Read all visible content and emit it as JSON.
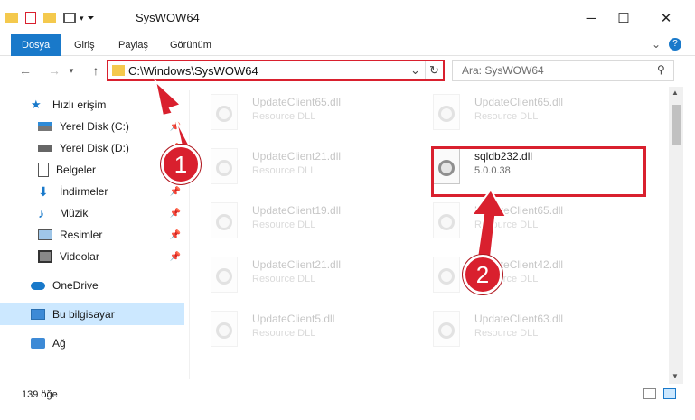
{
  "window": {
    "title": "SysWOW64",
    "minimize_icon": "minimize-icon",
    "maximize_icon": "maximize-icon",
    "close_icon": "close-icon"
  },
  "ribbon": {
    "tabs": [
      {
        "label": "Dosya",
        "active": true
      },
      {
        "label": "Giriş",
        "active": false
      },
      {
        "label": "Paylaş",
        "active": false
      },
      {
        "label": "Görünüm",
        "active": false
      }
    ]
  },
  "address": {
    "path": "C:\\Windows\\SysWOW64"
  },
  "search": {
    "placeholder": "Ara: SysWOW64"
  },
  "sidebar": {
    "items": [
      {
        "label": "Hızlı erişim"
      },
      {
        "label": "Yerel Disk (C:)"
      },
      {
        "label": "Yerel Disk (D:)"
      },
      {
        "label": "Belgeler"
      },
      {
        "label": "İndirmeler"
      },
      {
        "label": "Müzik"
      },
      {
        "label": "Resimler"
      },
      {
        "label": "Videolar"
      },
      {
        "label": "OneDrive"
      },
      {
        "label": "Bu bilgisayar"
      },
      {
        "label": "Ağ"
      }
    ]
  },
  "files": [
    {
      "name": "UpdateClient65.dll",
      "desc": "Resource DLL"
    },
    {
      "name": "UpdateClient65.dll",
      "desc": "Resource DLL"
    },
    {
      "name": "UpdateClient21.dll",
      "desc": "Resource DLL"
    },
    {
      "name": "sqldb232.dll",
      "desc": "5.0.0.38"
    },
    {
      "name": "UpdateClient19.dll",
      "desc": "Resource DLL"
    },
    {
      "name": "UpdateClient65.dll",
      "desc": "Resource DLL"
    },
    {
      "name": "UpdateClient21.dll",
      "desc": "Resource DLL"
    },
    {
      "name": "UpdateClient42.dll",
      "desc": "Resource DLL"
    },
    {
      "name": "UpdateClient5.dll",
      "desc": "Resource DLL"
    },
    {
      "name": "UpdateClient63.dll",
      "desc": "Resource DLL"
    }
  ],
  "status": {
    "count": "139 öğe"
  },
  "callouts": {
    "one": "1",
    "two": "2"
  },
  "colors": {
    "accent": "#1979ca",
    "highlight": "#d9202e",
    "selected": "#cce8ff"
  }
}
